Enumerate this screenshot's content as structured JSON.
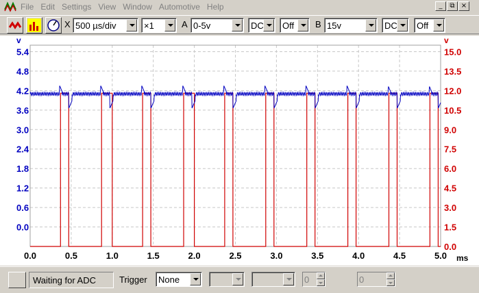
{
  "menu": {
    "items": [
      {
        "label": "File"
      },
      {
        "label": "Edit"
      },
      {
        "label": "Settings"
      },
      {
        "label": "View"
      },
      {
        "label": "Window"
      },
      {
        "label": "Automotive"
      },
      {
        "label": "Help"
      }
    ],
    "window_buttons": {
      "minimize": "_",
      "restore": "⧉",
      "close": "×"
    }
  },
  "toolbar": {
    "x_label": "X",
    "timebase": "500 µs/div",
    "multiplier": "×1",
    "channel_a": {
      "letter": "A",
      "range": "0-5v",
      "coupling": "DC",
      "option": "Off"
    },
    "channel_b": {
      "letter": "B",
      "range": "15v",
      "coupling": "DC",
      "option": "Off"
    }
  },
  "colors": {
    "channel_a": "#0000c0",
    "channel_b": "#d00000",
    "grid": "#c8c8c8"
  },
  "chart_data": {
    "type": "line",
    "title": "",
    "xlabel": "ms",
    "x_ticks": [
      "0.0",
      "0.5",
      "1.0",
      "1.5",
      "2.0",
      "2.5",
      "3.0",
      "3.5",
      "4.0",
      "4.5",
      "5.0"
    ],
    "xlim": [
      0,
      5
    ],
    "y_left": {
      "unit": "V",
      "ticks": [
        "0.0",
        "0.6",
        "1.2",
        "1.8",
        "2.4",
        "3.0",
        "3.6",
        "4.2",
        "4.8",
        "5.4"
      ],
      "ylim": [
        -0.6,
        5.6
      ]
    },
    "y_right": {
      "unit": "V",
      "ticks": [
        "0.0",
        "1.5",
        "3.0",
        "4.5",
        "6.0",
        "7.5",
        "9.0",
        "10.5",
        "12.0",
        "13.5",
        "15.0"
      ],
      "ylim": [
        0,
        15.5
      ]
    },
    "grid": true,
    "series": [
      {
        "name": "A",
        "axis": "left",
        "baseline": 4.1,
        "ripple": 0.05,
        "spike_high": 4.35,
        "spike_low": 3.65,
        "edge_times_ms": [
          0.37,
          0.87,
          1.37,
          1.87,
          2.37,
          2.87,
          3.37,
          3.87,
          4.37,
          4.87
        ]
      },
      {
        "name": "B",
        "axis": "right",
        "low": 0.0,
        "high": 11.8,
        "high_intervals_ms": [
          [
            0.37,
            0.47
          ],
          [
            0.87,
            1.0
          ],
          [
            1.37,
            1.47
          ],
          [
            1.87,
            2.0
          ],
          [
            2.37,
            2.47
          ],
          [
            2.87,
            2.97
          ],
          [
            3.37,
            3.47
          ],
          [
            3.87,
            3.97
          ],
          [
            4.37,
            4.47
          ],
          [
            4.87,
            4.97
          ]
        ]
      }
    ]
  },
  "status": {
    "message": "Waiting for ADC",
    "trigger_label": "Trigger",
    "trigger_mode": "None",
    "spin1_value": "0",
    "spin2_value": "0"
  }
}
